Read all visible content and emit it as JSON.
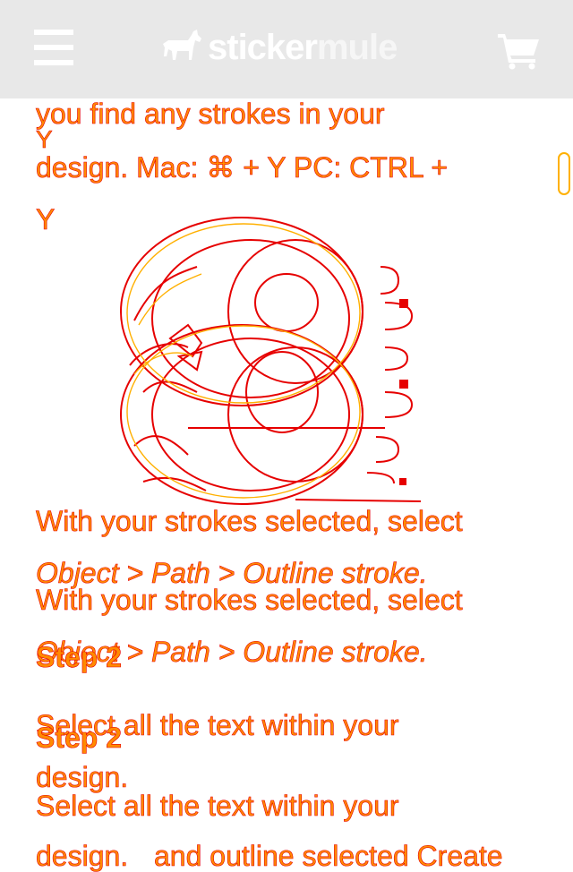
{
  "header": {
    "menu_icon": "hamburger-menu-icon",
    "logo": {
      "icon": "mule-icon",
      "sticker": "sticker",
      "mule": "mule"
    },
    "cart_icon": "shopping-cart-icon",
    "background": "#e8e8e8"
  },
  "content": {
    "line1": "you find any strokes in your",
    "stray_y": "Y",
    "line2": "design. Mac: ⌘ + Y PC: CTRL +",
    "line3": "Y",
    "illustration": "stroked-lettering-illustration",
    "para_a": "With your strokes selected, select",
    "path_a": "Object > Path > Outline stroke.",
    "para_b": "With your strokes selected, select",
    "path_b": "Object > Path > Outline stroke.",
    "step2_a": "Step 2",
    "select_a": "Select all the text within your",
    "step2_b": "Step 2",
    "design_a": "design.",
    "select_b": "Select all the text within your",
    "design_b": "design.",
    "trailing_fragment": "and outline selected Create"
  },
  "colors": {
    "text_fill": "#ff8a00",
    "text_outline": "#e60000",
    "accent": "#ffb000"
  }
}
